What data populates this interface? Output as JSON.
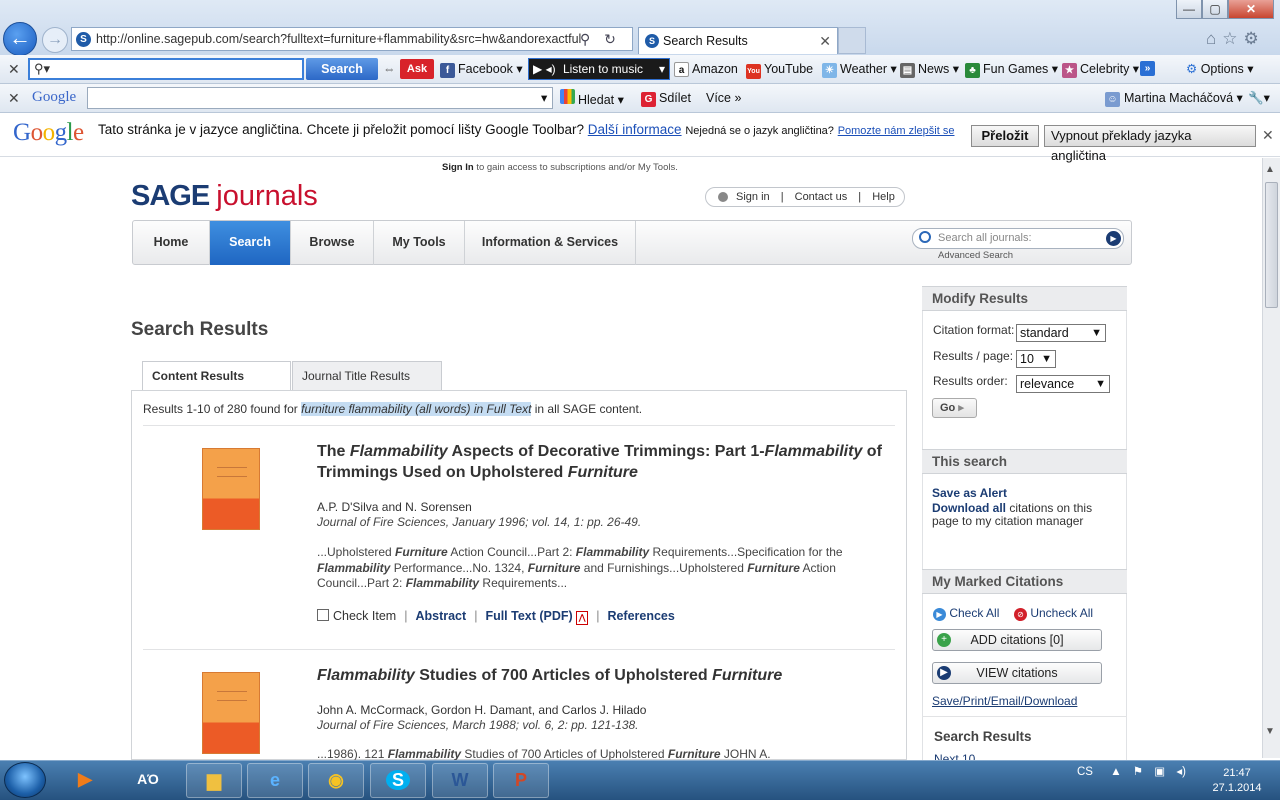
{
  "browser": {
    "url": "http://online.sagepub.com/search?fulltext=furniture+flammability&src=hw&andorexactful",
    "tab_title": "Search Results",
    "window_buttons": {
      "min": "—",
      "max": "▢",
      "close": "✕"
    }
  },
  "toolbar1": {
    "search_button": "Search",
    "items": [
      "Facebook",
      "Listen to music",
      "Amazon",
      "YouTube",
      "Weather",
      "News",
      "Fun Games",
      "Celebrity",
      "Options"
    ]
  },
  "toolbar2": {
    "google_label": "Google",
    "items": [
      "Hledat",
      "Sdílet",
      "Více",
      "Martina Macháčová"
    ]
  },
  "translate_bar": {
    "logo": "Google",
    "message": "Tato stránka je v jazyce angličtina. Chcete ji přeložit pomocí lišty Google Toolbar?",
    "more_info": "Další informace",
    "not_english": "Nejedná se o jazyk angličtina?",
    "help_link": "Pomozte nám zlepšit se",
    "translate_button": "Přeložit",
    "disable_button": "Vypnout překlady jazyka angličtina"
  },
  "header": {
    "signin_note_bold": "Sign In",
    "signin_note": "to gain access to subscriptions and/or My Tools.",
    "logo_sage": "SAGE",
    "logo_journals": "journals",
    "toplinks": [
      "Sign in",
      "Contact us",
      "Help"
    ]
  },
  "nav": {
    "tabs": [
      "Home",
      "Search",
      "Browse",
      "My Tools",
      "Information & Services"
    ],
    "search_placeholder": "Search all journals:",
    "advanced": "Advanced Search"
  },
  "main": {
    "title": "Search Results",
    "tabs": [
      "Content Results",
      "Journal Title Results"
    ],
    "summary_pre": "Results 1-10 of 280 found for",
    "summary_query": "furniture flammability (all words) in Full Text",
    "summary_post": "in all SAGE content.",
    "results": [
      {
        "title_html": "The <i>Flammability</i> Aspects of Decorative Trimmings: Part 1-<i>Flammability</i> of Trimmings Used on Upholstered <i>Furniture</i>",
        "authors": "A.P. D'Silva and N. Sorensen",
        "journal": "Journal of Fire Sciences, January 1996; vol. 14, 1: pp. 26-49.",
        "snippet_html": "...Upholstered <b><i>Furniture</i></b> Action Council...Part 2: <b><i>Flammability</i></b> Requirements...Specification for the <b><i>Flammability</i></b> Performance...No. 1324, <b><i>Furniture</i></b> and Furnishings...Upholstered <b><i>Furniture</i></b> Action Council...Part 2: <b><i>Flammability</i></b> Requirements...",
        "actions": [
          "Check Item",
          "Abstract",
          "Full Text (PDF)",
          "References"
        ]
      },
      {
        "title_html": "<i>Flammability</i> Studies of 700 Articles of Upholstered <i>Furniture</i>",
        "authors": "John A. McCormack, Gordon H. Damant, and Carlos J. Hilado",
        "journal": "Journal of Fire Sciences, March 1988; vol. 6, 2: pp. 121-138.",
        "snippet_html": "...1986). 121 <b><i>Flammability</i></b> Studies of 700 Articles of Upholstered <b><i>Furniture</i></b> JOHN A."
      }
    ]
  },
  "sidebar": {
    "modify_title": "Modify Results",
    "citation_label": "Citation format:",
    "citation_value": "standard",
    "perpage_label": "Results / page:",
    "perpage_value": "10",
    "order_label": "Results order:",
    "order_value": "relevance",
    "go": "Go",
    "this_search_title": "This search",
    "save_alert": "Save as Alert",
    "download_all": "Download all",
    "download_rest": "citations on this page to my citation manager",
    "marked_title": "My Marked Citations",
    "check_all": "Check All",
    "uncheck_all": "Uncheck All",
    "add_citations": "ADD citations [0]",
    "view_citations": "VIEW citations",
    "save_print": "Save/Print/Email/Download",
    "search_results_title": "Search Results",
    "next": "Next 10"
  },
  "taskbar": {
    "lang": "CS",
    "time": "21:47",
    "date": "27.1.2014"
  }
}
